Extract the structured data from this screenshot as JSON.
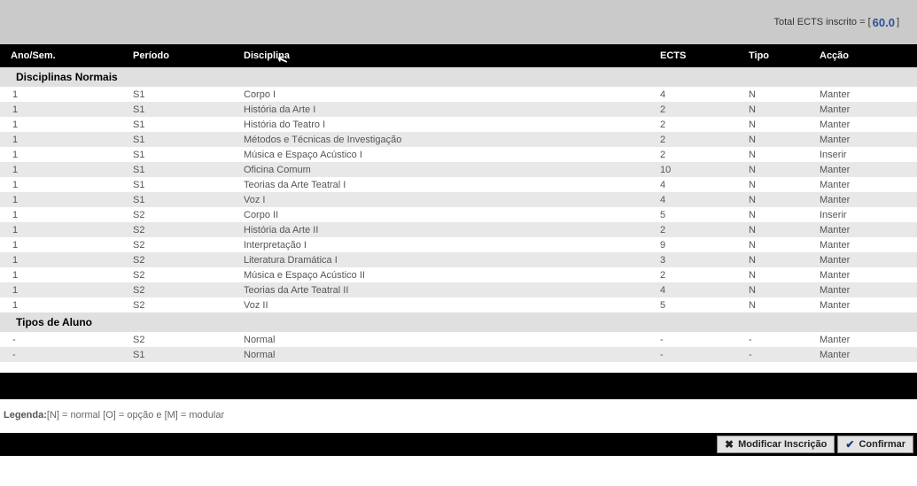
{
  "top": {
    "label_prefix": "Total ECTS inscrito = [ ",
    "ects_value": "60.0",
    "label_suffix": " ]"
  },
  "headers": {
    "ano_sem": "Ano/Sem.",
    "periodo": "Período",
    "disciplina": "Disciplina",
    "ects": "ECTS",
    "tipo": "Tipo",
    "accao": "Acção"
  },
  "section1": {
    "title": "Disciplinas Normais",
    "rows": [
      {
        "ano": "1",
        "periodo": "S1",
        "disciplina": "Corpo I",
        "ects": "4",
        "tipo": "N",
        "accao": "Manter"
      },
      {
        "ano": "1",
        "periodo": "S1",
        "disciplina": "História da Arte I",
        "ects": "2",
        "tipo": "N",
        "accao": "Manter"
      },
      {
        "ano": "1",
        "periodo": "S1",
        "disciplina": "História do Teatro I",
        "ects": "2",
        "tipo": "N",
        "accao": "Manter"
      },
      {
        "ano": "1",
        "periodo": "S1",
        "disciplina": "Métodos e Técnicas de Investigação",
        "ects": "2",
        "tipo": "N",
        "accao": "Manter"
      },
      {
        "ano": "1",
        "periodo": "S1",
        "disciplina": "Música e Espaço Acústico I",
        "ects": "2",
        "tipo": "N",
        "accao": "Inserir"
      },
      {
        "ano": "1",
        "periodo": "S1",
        "disciplina": "Oficina Comum",
        "ects": "10",
        "tipo": "N",
        "accao": "Manter"
      },
      {
        "ano": "1",
        "periodo": "S1",
        "disciplina": "Teorias da Arte Teatral I",
        "ects": "4",
        "tipo": "N",
        "accao": "Manter"
      },
      {
        "ano": "1",
        "periodo": "S1",
        "disciplina": "Voz I",
        "ects": "4",
        "tipo": "N",
        "accao": "Manter"
      },
      {
        "ano": "1",
        "periodo": "S2",
        "disciplina": "Corpo II",
        "ects": "5",
        "tipo": "N",
        "accao": "Inserir"
      },
      {
        "ano": "1",
        "periodo": "S2",
        "disciplina": "História da Arte II",
        "ects": "2",
        "tipo": "N",
        "accao": "Manter"
      },
      {
        "ano": "1",
        "periodo": "S2",
        "disciplina": "Interpretação I",
        "ects": "9",
        "tipo": "N",
        "accao": "Manter"
      },
      {
        "ano": "1",
        "periodo": "S2",
        "disciplina": "Literatura Dramática I",
        "ects": "3",
        "tipo": "N",
        "accao": "Manter"
      },
      {
        "ano": "1",
        "periodo": "S2",
        "disciplina": "Música e Espaço Acústico II",
        "ects": "2",
        "tipo": "N",
        "accao": "Manter"
      },
      {
        "ano": "1",
        "periodo": "S2",
        "disciplina": "Teorias da Arte Teatral II",
        "ects": "4",
        "tipo": "N",
        "accao": "Manter"
      },
      {
        "ano": "1",
        "periodo": "S2",
        "disciplina": "Voz II",
        "ects": "5",
        "tipo": "N",
        "accao": "Manter"
      }
    ]
  },
  "section2": {
    "title": "Tipos de Aluno",
    "rows": [
      {
        "ano": "-",
        "periodo": "S2",
        "disciplina": "Normal",
        "ects": "-",
        "tipo": "-",
        "accao": "Manter"
      },
      {
        "ano": "-",
        "periodo": "S1",
        "disciplina": "Normal",
        "ects": "-",
        "tipo": "-",
        "accao": "Manter"
      }
    ]
  },
  "legend": {
    "label": "Legenda:",
    "text": "[N] = normal [O] = opção e [M] = modular"
  },
  "buttons": {
    "modify": "Modificar Inscrição",
    "confirm": "Confirmar"
  }
}
